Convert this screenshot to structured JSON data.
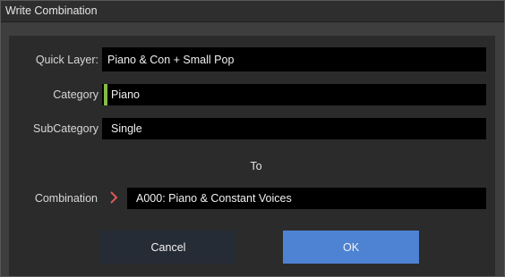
{
  "window": {
    "title": "Write Combination"
  },
  "form": {
    "quick_layer": {
      "label": "Quick Layer:",
      "value": "Piano & Con + Small Pop"
    },
    "category": {
      "label": "Category",
      "value": "Piano",
      "color": "#86b949"
    },
    "subcategory": {
      "label": "SubCategory",
      "value": "Single"
    },
    "to_label": "To",
    "combination": {
      "label": "Combination",
      "value": "A000: Piano & Constant Voices",
      "icon": "chevron-right-icon",
      "icon_color": "#e05a5a"
    }
  },
  "buttons": {
    "cancel_label": "Cancel",
    "ok_label": "OK",
    "ok_color": "#4d83d2"
  }
}
